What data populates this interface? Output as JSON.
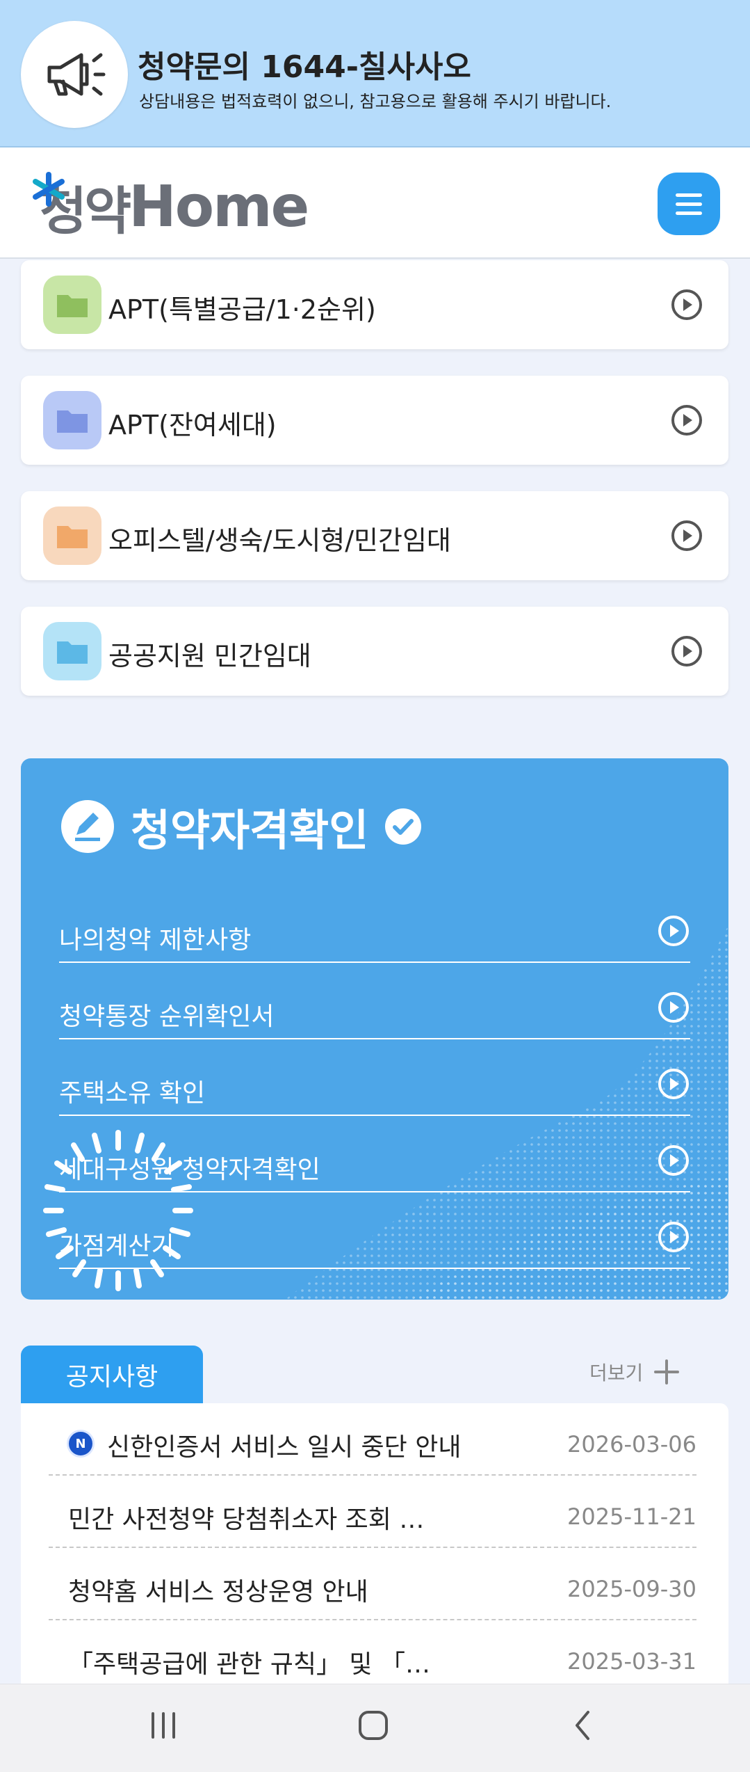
{
  "banner": {
    "title": "청약문의 1644-칠사사오",
    "subtitle": "상담내용은 법적효력이 없으니, 참고용으로 활용해 주시기 바랍니다."
  },
  "header": {
    "logo_ko": "청약",
    "logo_en": "Home"
  },
  "categories": [
    {
      "label": "APT(특별공급/1·2순위)",
      "color": "#c8e6a6",
      "folder": "#8fbf5e"
    },
    {
      "label": "APT(잔여세대)",
      "color": "#b9c9f6",
      "folder": "#7e95e3"
    },
    {
      "label": "오피스텔/생숙/도시형/민간임대",
      "color": "#f8d8bd",
      "folder": "#f1a869"
    },
    {
      "label": "공공지원 민간임대",
      "color": "#b4e3f7",
      "folder": "#5cb8e6"
    }
  ],
  "qualification": {
    "title": "청약자격확인",
    "items": [
      {
        "label": "나의청약 제한사항"
      },
      {
        "label": "청약통장 순위확인서"
      },
      {
        "label": "주택소유 확인"
      },
      {
        "label": "세대구성원 청약자격확인"
      },
      {
        "label": "가점계산기"
      }
    ]
  },
  "notice": {
    "tab_label": "공지사항",
    "more_label": "더보기",
    "new_badge": "N",
    "items": [
      {
        "title": "신한인증서 서비스 일시 중단 안내",
        "date": "2026-03-06"
      },
      {
        "title": "민간 사전청약 당첨취소자 조회 …",
        "date": "2025-11-21"
      },
      {
        "title": "청약홈 서비스 정상운영 안내",
        "date": "2025-09-30"
      },
      {
        "title": "「주택공급에 관한 규칙」 및 「…",
        "date": "2025-03-31"
      }
    ]
  },
  "colors": {
    "accent": "#2e9ff0",
    "banner": "#b6dcfb",
    "panel": "#4da6e8"
  }
}
